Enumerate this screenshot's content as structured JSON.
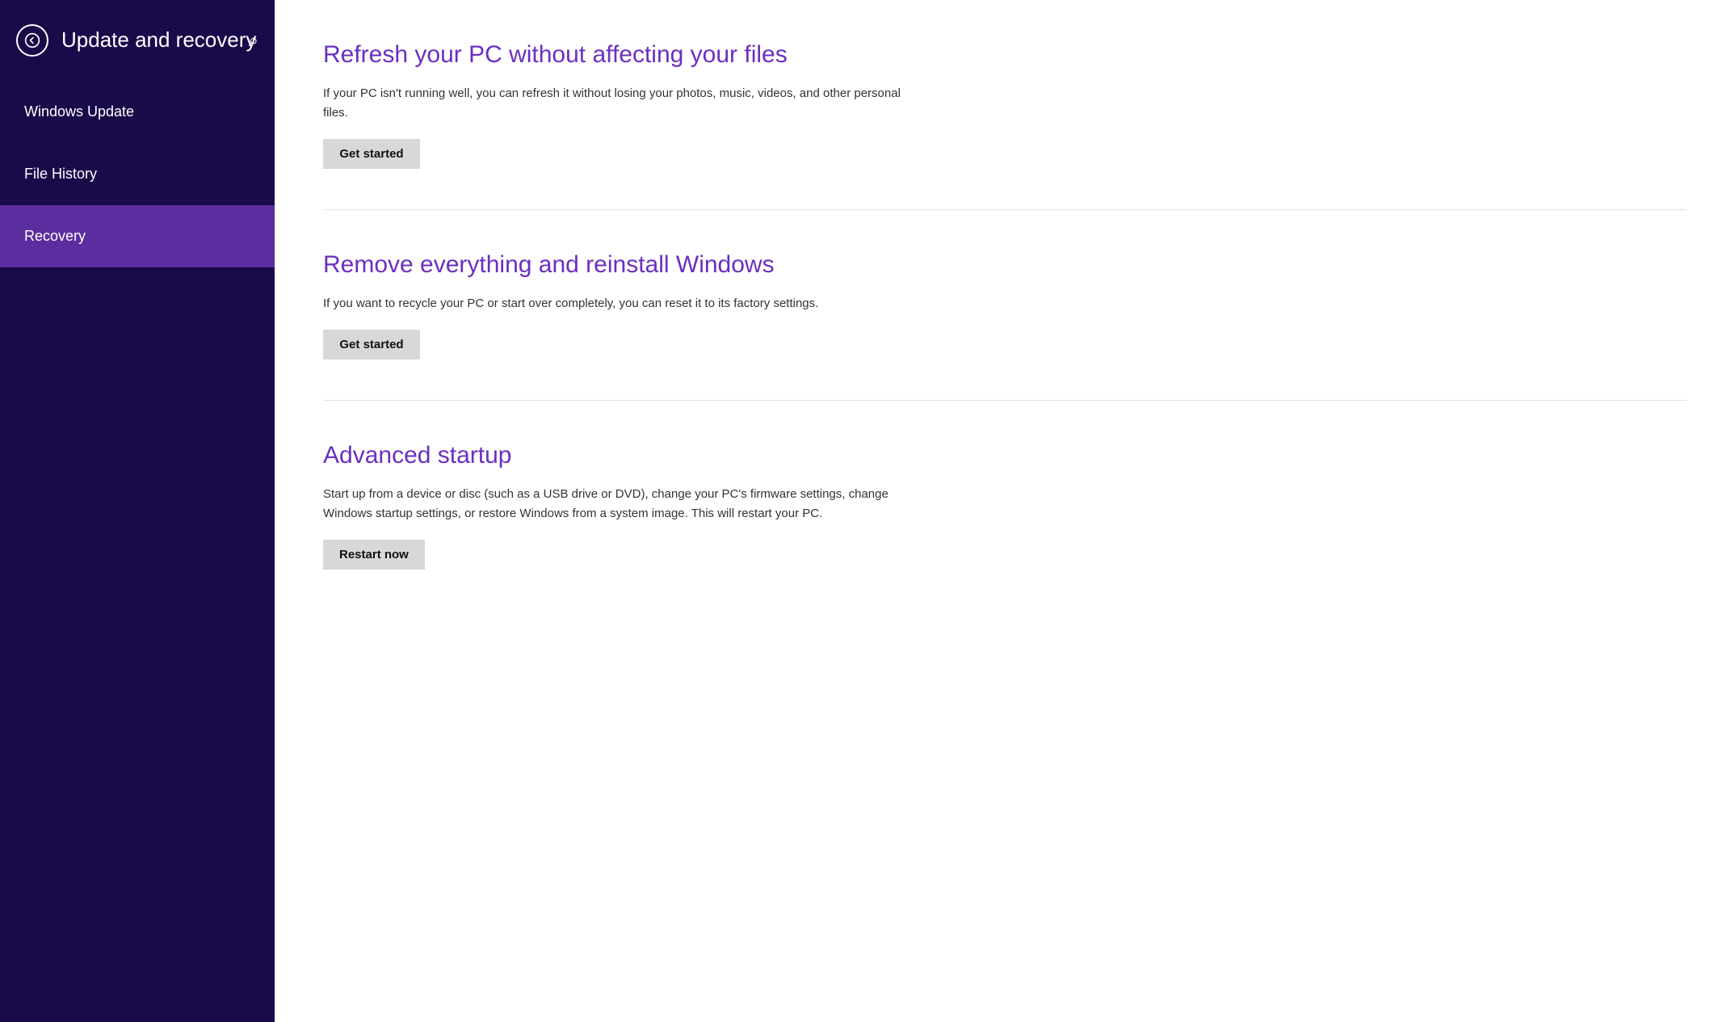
{
  "sidebar": {
    "back_icon": "←",
    "title": "Update and recovery",
    "search_icon": "🔍",
    "nav_items": [
      {
        "id": "windows-update",
        "label": "Windows Update",
        "active": false
      },
      {
        "id": "file-history",
        "label": "File History",
        "active": false
      },
      {
        "id": "recovery",
        "label": "Recovery",
        "active": true
      }
    ]
  },
  "main": {
    "sections": [
      {
        "id": "refresh",
        "title": "Refresh your PC without affecting your files",
        "description": "If your PC isn't running well, you can refresh it without losing your photos, music, videos, and other personal files.",
        "button_label": "Get started"
      },
      {
        "id": "reset",
        "title": "Remove everything and reinstall Windows",
        "description": "If you want to recycle your PC or start over completely, you can reset it to its factory settings.",
        "button_label": "Get started"
      },
      {
        "id": "advanced",
        "title": "Advanced startup",
        "description": "Start up from a device or disc (such as a USB drive or DVD), change your PC's firmware settings, change Windows startup settings, or restore Windows from a system image. This will restart your PC.",
        "button_label": "Restart now"
      }
    ]
  }
}
